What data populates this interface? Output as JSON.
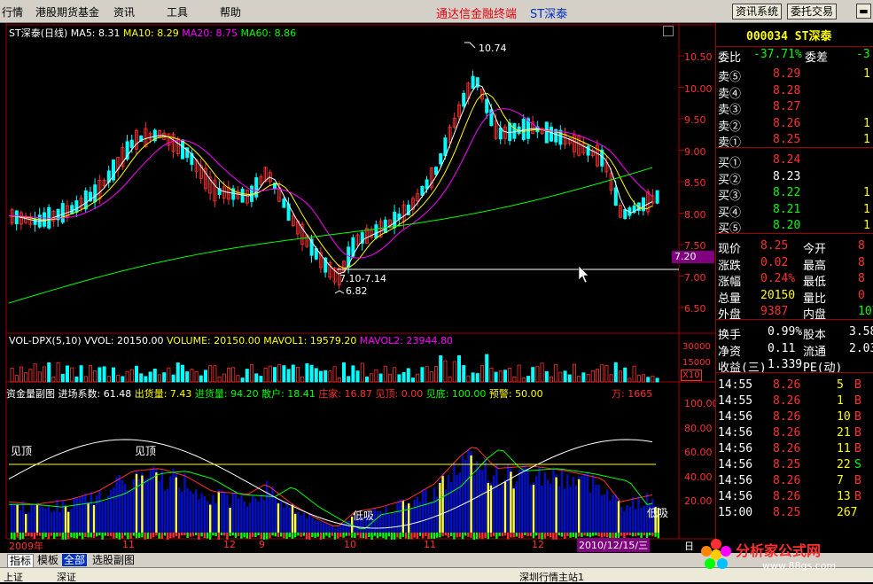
{
  "menubar": {
    "items": [
      "行情",
      "港股期货基金",
      "资讯",
      "工具",
      "帮助"
    ],
    "app_title": "通达信金融终端",
    "stock_title": "ST深泰",
    "btn_info": "资讯系统",
    "btn_trade": "委托交易"
  },
  "main": {
    "title": "ST深泰(日线)",
    "ma5": "MA5: 8.31",
    "ma10": "MA10: 8.29",
    "ma20": "MA20: 8.75",
    "ma60": "MA60: 8.86",
    "high_label": "10.74",
    "low_label": "6.82",
    "range_label": "7.10-7.14",
    "current_price_tag": "7.20",
    "price_ticks": [
      "10.50",
      "10.00",
      "9.50",
      "9.00",
      "8.50",
      "8.00",
      "7.50",
      "7.00",
      "6.50"
    ]
  },
  "volume": {
    "title": "VOL-DPX(5,10)",
    "vvol": "VVOL: 20150.00",
    "volume": "VOLUME: 20150.00",
    "mavol1": "MAVOL1: 19579.20",
    "mavol2": "MAVOL2: 23944.80",
    "ticks": [
      "30000",
      "15000"
    ],
    "unit": "X10"
  },
  "fund": {
    "title": "资金量副图",
    "items": [
      "进场系数: 61.48",
      "出货量: 7.43",
      "进货量: 94.20",
      "散户: 18.41",
      "庄家: 16.87",
      "见顶: 0.00",
      "见底: 100.00",
      "预警: 50.00"
    ],
    "unit_label": "万: 1665",
    "ticks": [
      "100.00",
      "80.00",
      "60.00",
      "40.00",
      "20.00"
    ],
    "label_top1": "见顶",
    "label_top2": "见顶",
    "label_absorb": "低吸",
    "label_absorb2": "低吸"
  },
  "time_axis": {
    "labels": [
      "2009年",
      "11",
      "12",
      "9",
      "10",
      "11",
      "12"
    ],
    "current_date": "2010/12/15/三",
    "day_label": "日"
  },
  "quote": {
    "header": "000034 ST深泰",
    "weibi_label": "委比",
    "weibi_value": "-37.71%",
    "weicha_label": "委差",
    "weicha_value": "-3",
    "asks": [
      {
        "label": "卖⑤",
        "price": "8.29",
        "vol": "1"
      },
      {
        "label": "卖④",
        "price": "8.28",
        "vol": ""
      },
      {
        "label": "卖③",
        "price": "8.27",
        "vol": ""
      },
      {
        "label": "卖②",
        "price": "8.26",
        "vol": "1"
      },
      {
        "label": "卖①",
        "price": "8.25",
        "vol": "1"
      }
    ],
    "bids": [
      {
        "label": "买①",
        "price": "8.24",
        "vol": ""
      },
      {
        "label": "买②",
        "price": "8.23",
        "vol": ""
      },
      {
        "label": "买③",
        "price": "8.22",
        "vol": "1"
      },
      {
        "label": "买④",
        "price": "8.21",
        "vol": "1"
      },
      {
        "label": "买⑤",
        "price": "8.20",
        "vol": "1"
      }
    ],
    "stats": [
      {
        "l1": "现价",
        "v1": "8.25",
        "l2": "今开",
        "v2": "8"
      },
      {
        "l1": "涨跌",
        "v1": "0.02",
        "l2": "最高",
        "v2": "8"
      },
      {
        "l1": "涨幅",
        "v1": "0.24%",
        "l2": "最低",
        "v2": "8"
      },
      {
        "l1": "总量",
        "v1": "20150",
        "l2": "量比",
        "v2": "0"
      },
      {
        "l1": "外盘",
        "v1": "9387",
        "l2": "内盘",
        "v2": "107"
      }
    ],
    "fin": [
      {
        "l1": "换手",
        "v1": "0.99%",
        "l2": "股本",
        "v2": "3.58"
      },
      {
        "l1": "净资",
        "v1": "0.11",
        "l2": "流通",
        "v2": "2.03"
      },
      {
        "l1": "收益(三)",
        "v1": "1.339",
        "l2": "PE(动)",
        "v2": ""
      }
    ],
    "ticks": [
      {
        "time": "14:55",
        "price": "8.26",
        "vol": "5",
        "dir": "B"
      },
      {
        "time": "14:55",
        "price": "8.26",
        "vol": "1",
        "dir": "B"
      },
      {
        "time": "14:56",
        "price": "8.26",
        "vol": "10",
        "dir": "B"
      },
      {
        "time": "14:56",
        "price": "8.26",
        "vol": "21",
        "dir": "B"
      },
      {
        "time": "14:56",
        "price": "8.26",
        "vol": "11",
        "dir": "B"
      },
      {
        "time": "14:56",
        "price": "8.25",
        "vol": "22",
        "dir": "S"
      },
      {
        "time": "14:56",
        "price": "8.26",
        "vol": "7",
        "dir": "B"
      },
      {
        "time": "14:56",
        "price": "8.26",
        "vol": "13",
        "dir": "B"
      },
      {
        "time": "15:00",
        "price": "8.25",
        "vol": "267",
        "dir": ""
      }
    ]
  },
  "bottom_tabs": [
    "指标",
    "模板",
    "全部",
    "选股副图"
  ],
  "statusbar": {
    "items": [
      "上证",
      "深证",
      "深圳行情主站1"
    ]
  },
  "logo": {
    "text": "分析家公式网",
    "url": "www.88gs.com"
  }
}
